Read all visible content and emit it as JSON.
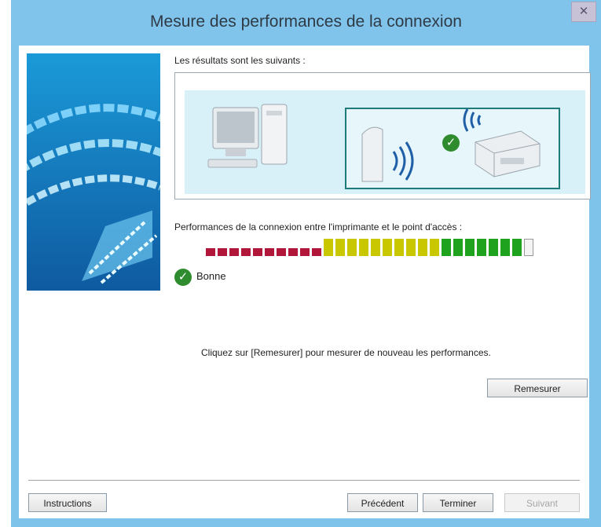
{
  "window": {
    "title": "Mesure des performances de la connexion",
    "close_glyph": "✕"
  },
  "results": {
    "label": "Les résultats sont les suivants :"
  },
  "performance": {
    "label": "Performances de la connexion entre l'imprimante et le point d'accès :",
    "level_fraction": 0.95,
    "status": "Bonne"
  },
  "info": {
    "text": "Cliquez sur [Remesurer] pour mesurer de nouveau les performances."
  },
  "buttons": {
    "remeasure": "Remesurer",
    "instructions": "Instructions",
    "previous": "Précédent",
    "finish": "Terminer",
    "next": "Suivant"
  },
  "colors": {
    "accent": "#80c4ec",
    "good": "#2e8b2e",
    "meter_red": "#b0173a",
    "meter_yellow": "#c9c800",
    "meter_green": "#1fa31f"
  },
  "icons": {
    "computer": "computer-icon",
    "access_point": "access-point-icon",
    "printer": "printer-icon",
    "status_ok": "check-icon"
  }
}
